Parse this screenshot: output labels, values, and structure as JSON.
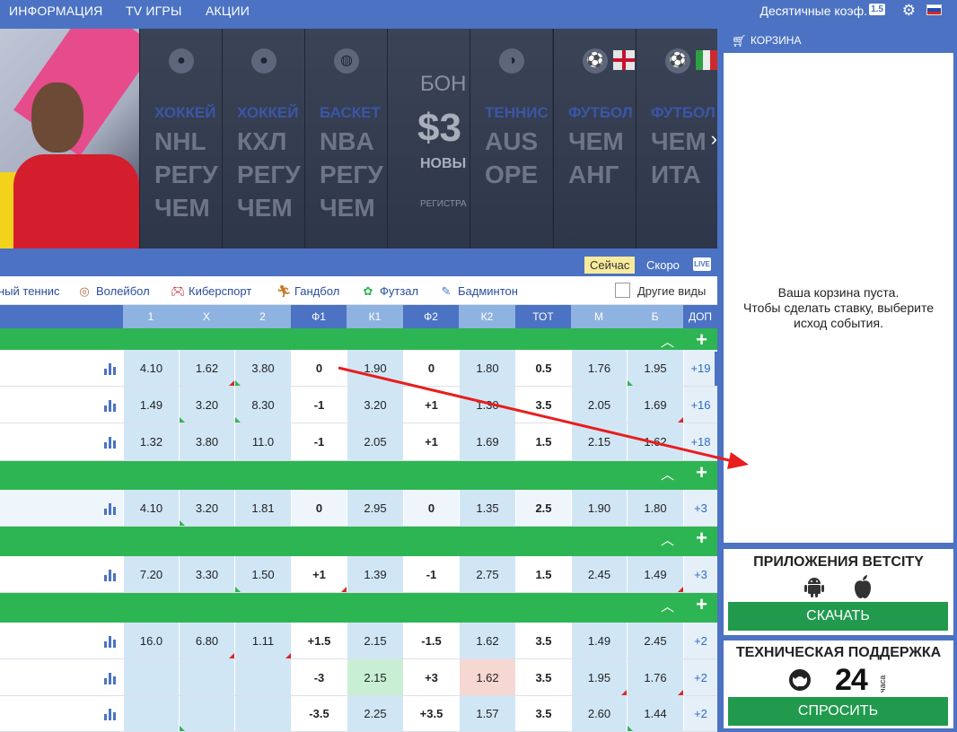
{
  "topnav": {
    "links": [
      "ИНФОРМАЦИЯ",
      "TV ИГРЫ",
      "АКЦИИ"
    ],
    "coef_label": "Десятичные коэф.",
    "coef_badge": "1.5",
    "icons": [
      "gear-icon",
      "russia-flag-icon"
    ]
  },
  "banner": {
    "cards": [
      {
        "sport": "ХОККЕЙ",
        "lines": [
          "NHL",
          "РЕГУ",
          "ЧЕМ"
        ]
      },
      {
        "sport": "ХОККЕЙ",
        "lines": [
          "КХЛ",
          "РЕГУ",
          "ЧЕМ"
        ]
      },
      {
        "sport": "БАСКЕТ",
        "lines": [
          "NBA",
          "РЕГУ",
          "ЧЕМ"
        ]
      },
      {
        "sport": "",
        "lines": [
          "БОН",
          "$3",
          "НОВЫ"
        ],
        "bonus": true,
        "note": "РЕГИСТРА"
      },
      {
        "sport": "ТЕННИС",
        "lines": [
          "AUS",
          "OPE"
        ]
      },
      {
        "sport": "ФУТБОЛ",
        "lines": [
          "ЧЕМ",
          "АНГ"
        ]
      },
      {
        "sport": "ФУТБОЛ",
        "lines": [
          "ЧЕМ",
          "ИТА"
        ]
      }
    ]
  },
  "toolbar": {
    "now": "Сейчас",
    "soon": "Скоро",
    "live": "LIVE"
  },
  "sports": {
    "items": [
      {
        "label": "ный теннис",
        "icon": ""
      },
      {
        "label": "Волейбол",
        "icon": "volleyball-icon"
      },
      {
        "label": "Киберспорт",
        "icon": "gamepad-icon"
      },
      {
        "label": "Гандбол",
        "icon": "handball-icon"
      },
      {
        "label": "Футзал",
        "icon": "futsal-icon"
      },
      {
        "label": "Бадминтон",
        "icon": "badminton-icon"
      }
    ],
    "other": "Другие виды"
  },
  "table": {
    "headers": [
      "1",
      "X",
      "2",
      "Ф1",
      "К1",
      "Ф2",
      "К2",
      "ТОТ",
      "М",
      "Б",
      "ДОП"
    ],
    "rows": [
      [
        "4.10",
        "1.62",
        "3.80",
        "0",
        "1.90",
        "0",
        "1.80",
        "0.5",
        "1.76",
        "1.95",
        "+19"
      ],
      [
        "1.49",
        "3.20",
        "8.30",
        "-1",
        "3.20",
        "+1",
        "1.30",
        "3.5",
        "2.05",
        "1.69",
        "+16"
      ],
      [
        "1.32",
        "3.80",
        "11.0",
        "-1",
        "2.05",
        "+1",
        "1.69",
        "1.5",
        "2.15",
        "1.62",
        "+18"
      ],
      [
        "4.10",
        "3.20",
        "1.81",
        "0",
        "2.95",
        "0",
        "1.35",
        "2.5",
        "1.90",
        "1.80",
        "+3"
      ],
      [
        "7.20",
        "3.30",
        "1.50",
        "+1",
        "1.39",
        "-1",
        "2.75",
        "1.5",
        "2.45",
        "1.49",
        "+3"
      ],
      [
        "16.0",
        "6.80",
        "1.11",
        "+1.5",
        "2.15",
        "-1.5",
        "1.62",
        "3.5",
        "1.49",
        "2.45",
        "+2"
      ],
      [
        "",
        "",
        "",
        "-3",
        "2.15",
        "+3",
        "1.62",
        "3.5",
        "1.95",
        "1.76",
        "+2"
      ],
      [
        "",
        "",
        "",
        "-3.5",
        "2.25",
        "+3.5",
        "1.57",
        "3.5",
        "2.60",
        "1.44",
        "+2"
      ]
    ]
  },
  "cart": {
    "title": "КОРЗИНА",
    "empty_line1": "Ваша корзина пуста.",
    "empty_line2": "Чтобы сделать ставку, выберите",
    "empty_line3": "исход события."
  },
  "apps": {
    "title": "ПРИЛОЖЕНИЯ BETCITY",
    "download": "СКАЧАТЬ"
  },
  "support": {
    "title": "ТЕХНИЧЕСКАЯ ПОДДЕРЖКА",
    "hours": "24",
    "hours_unit": "часа",
    "ask": "СПРОСИТЬ"
  },
  "colors": {
    "brand_blue": "#4b72c3",
    "group_green": "#2eb553",
    "button_green": "#219a4d",
    "odd_cell": "#d1e6f5",
    "annotation_red": "#e81d1d"
  }
}
